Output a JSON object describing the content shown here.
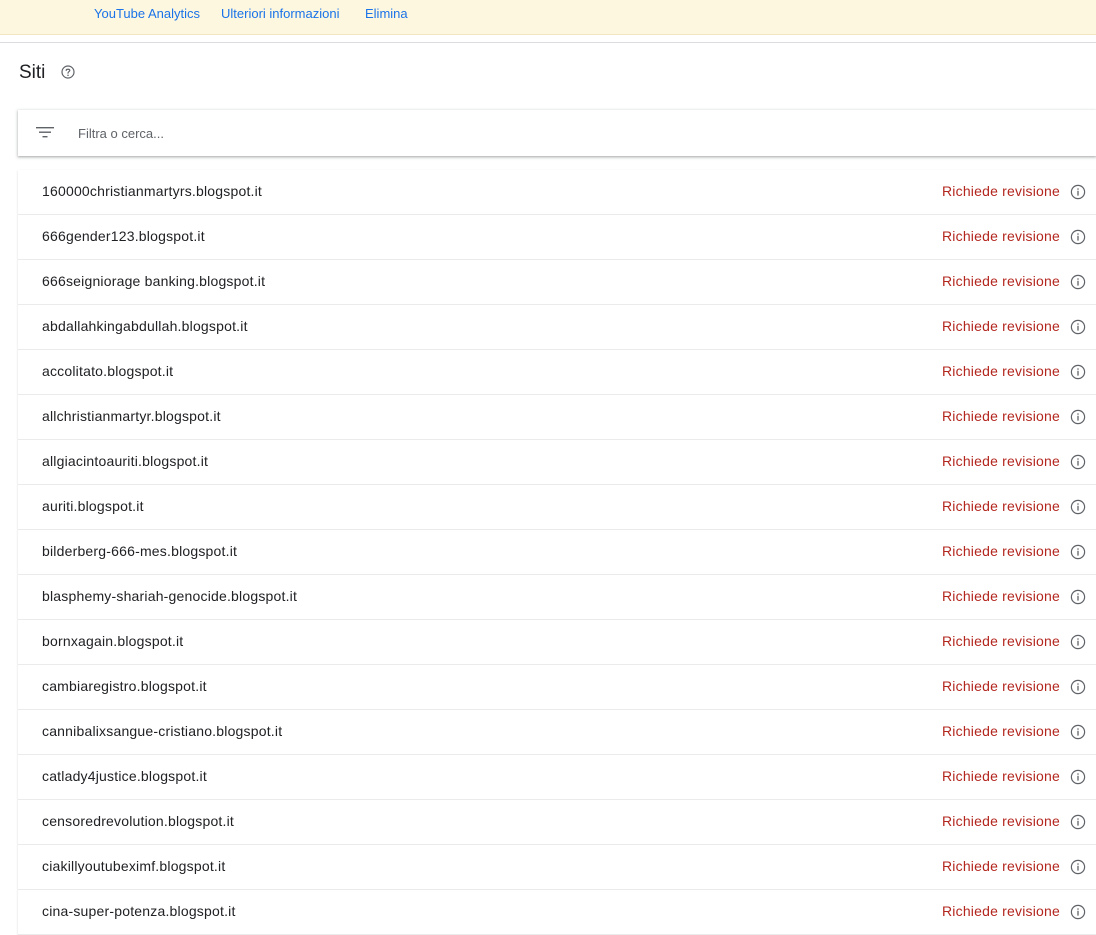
{
  "banner": {
    "links": [
      "YouTube Analytics",
      "Ulteriori informazioni",
      "Elimina"
    ]
  },
  "page": {
    "title": "Siti"
  },
  "filter": {
    "placeholder": "Filtra o cerca..."
  },
  "sites": [
    {
      "name": "160000christianmartyrs.blogspot.it",
      "status": "Richiede revisione"
    },
    {
      "name": "666gender123.blogspot.it",
      "status": "Richiede revisione"
    },
    {
      "name": "666seigniorage banking.blogspot.it",
      "status": "Richiede revisione"
    },
    {
      "name": "abdallahkingabdullah.blogspot.it",
      "status": "Richiede revisione"
    },
    {
      "name": "accolitato.blogspot.it",
      "status": "Richiede revisione"
    },
    {
      "name": "allchristianmartyr.blogspot.it",
      "status": "Richiede revisione"
    },
    {
      "name": "allgiacintoauriti.blogspot.it",
      "status": "Richiede revisione"
    },
    {
      "name": "auriti.blogspot.it",
      "status": "Richiede revisione"
    },
    {
      "name": "bilderberg-666-mes.blogspot.it",
      "status": "Richiede revisione"
    },
    {
      "name": "blasphemy-shariah-genocide.blogspot.it",
      "status": "Richiede revisione"
    },
    {
      "name": "bornxagain.blogspot.it",
      "status": "Richiede revisione"
    },
    {
      "name": "cambiaregistro.blogspot.it",
      "status": "Richiede revisione"
    },
    {
      "name": "cannibalixsangue-cristiano.blogspot.it",
      "status": "Richiede revisione"
    },
    {
      "name": "catlady4justice.blogspot.it",
      "status": "Richiede revisione"
    },
    {
      "name": "censoredrevolution.blogspot.it",
      "status": "Richiede revisione"
    },
    {
      "name": "ciakillyoutubeximf.blogspot.it",
      "status": "Richiede revisione"
    },
    {
      "name": "cina-super-potenza.blogspot.it",
      "status": "Richiede revisione"
    }
  ],
  "icons": {
    "help": "help-circle-icon",
    "filter": "filter-list-icon",
    "info": "info-circle-icon"
  },
  "colors": {
    "banner_bg": "#fef7e0",
    "link": "#1a73e8",
    "status_text": "#b3261e"
  }
}
